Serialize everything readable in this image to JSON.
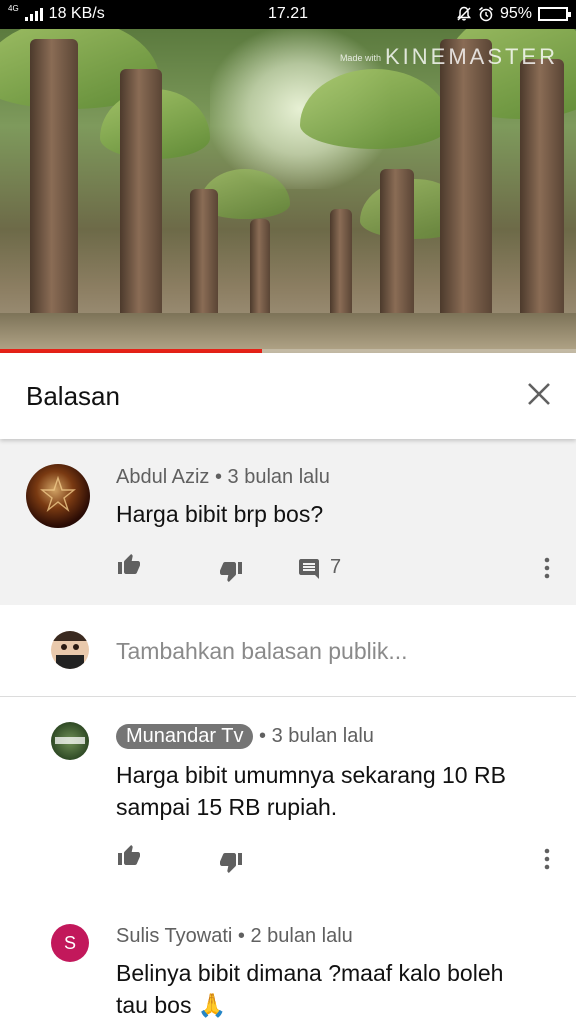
{
  "status_bar": {
    "network_type": "4G",
    "speed": "18 KB/s",
    "time": "17.21",
    "battery": "95%",
    "battery_level": 0.95
  },
  "video": {
    "watermark_made": "Made with",
    "watermark": "KINEMASTER",
    "progress": 0.455,
    "progress_color": "#e62117"
  },
  "header": {
    "title": "Balasan",
    "close_icon": "close-icon"
  },
  "parent_comment": {
    "author": "Abdul Aziz",
    "time": "3 bulan lalu",
    "text": "Harga bibit brp bos?",
    "reply_count": "7"
  },
  "reply_input": {
    "placeholder": "Tambahkan balasan publik..."
  },
  "replies": [
    {
      "author": "Munandar Tv",
      "is_channel_owner": true,
      "time": "3 bulan lalu",
      "text_line1": "Harga bibit umumnya sekarang 10 RB",
      "text_line2": "sampai 15 RB rupiah."
    },
    {
      "author": "Sulis Tyowati",
      "avatar_letter": "S",
      "avatar_color": "#c2185b",
      "time": "2 bulan lalu",
      "text_line1": "Belinya bibit dimana ?maaf kalo boleh",
      "text_line2": "tau bos",
      "emoji": "🙏"
    }
  ],
  "separator": "•"
}
